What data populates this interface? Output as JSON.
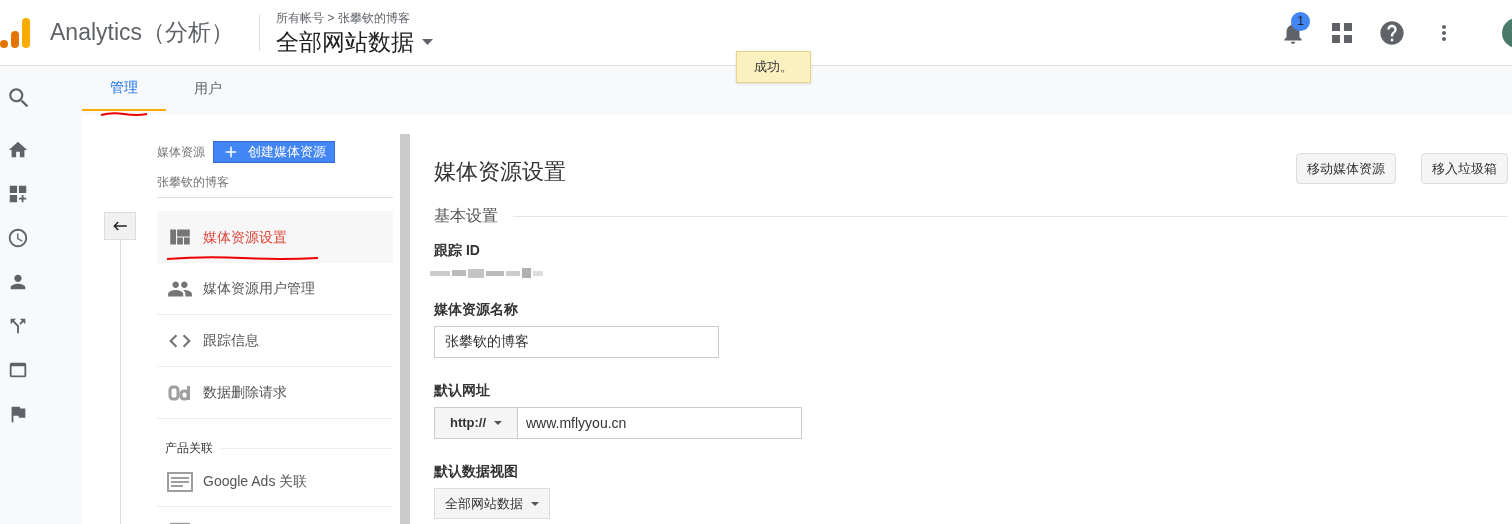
{
  "header": {
    "product": "Analytics（分析）",
    "breadcrumb": "所有帐号 > 张攀钦的博客",
    "view_selector": "全部网站数据",
    "notification_count": "1"
  },
  "toast": "成功。",
  "tabs": [
    {
      "label": "管理",
      "selected": true,
      "underlined": true
    },
    {
      "label": "用户",
      "selected": false,
      "underlined": false
    }
  ],
  "property_column": {
    "label": "媒体资源",
    "create_button": "创建媒体资源",
    "property_name": "张攀钦的博客",
    "items": [
      {
        "kind": "settings",
        "label": "媒体资源设置",
        "selected": true,
        "underlined": true
      },
      {
        "kind": "users",
        "label": "媒体资源用户管理",
        "selected": false,
        "underlined": false
      },
      {
        "kind": "code",
        "label": "跟踪信息",
        "selected": false,
        "underlined": false
      },
      {
        "kind": "delete",
        "label": "数据删除请求",
        "selected": false,
        "underlined": false
      }
    ],
    "section": "产品关联",
    "links": [
      {
        "kind": "ads",
        "label": "Google Ads 关联"
      },
      {
        "kind": "adsense"
      }
    ]
  },
  "settings": {
    "title": "媒体资源设置",
    "buttons": [
      "移动媒体资源",
      "移入垃圾箱"
    ],
    "section": "基本设置",
    "fields": [
      {
        "kind": "redacted",
        "label": "跟踪 ID"
      },
      {
        "kind": "text",
        "label": "媒体资源名称",
        "value": "张攀钦的博客"
      },
      {
        "kind": "url",
        "label": "默认网址",
        "protocol": "http://",
        "value": "www.mflyyou.cn"
      },
      {
        "kind": "select",
        "label": "默认数据视图",
        "value": "全部网站数据"
      }
    ]
  }
}
